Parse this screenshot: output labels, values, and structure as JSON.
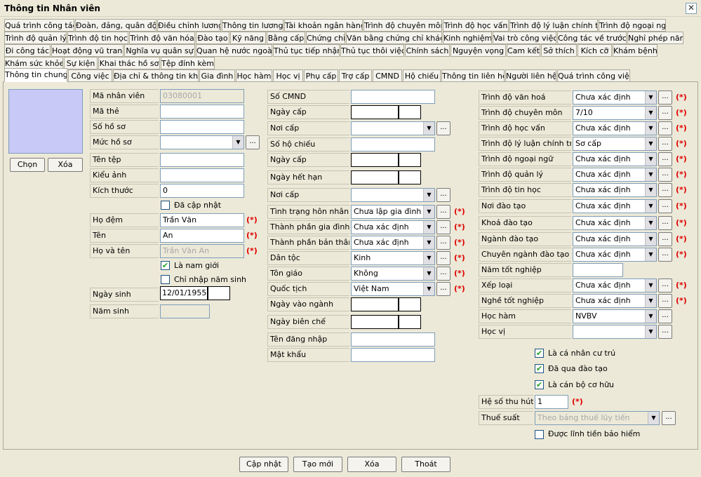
{
  "window": {
    "title": "Thông tin Nhân viên",
    "close": "✕"
  },
  "tabs": {
    "row1": [
      "Quá trình công tác",
      "Đoàn, đảng, quân đội",
      "Điều chỉnh lương",
      "Thông tin lương",
      "Tài khoản ngân hàng",
      "Trình độ chuyên môn",
      "Trình độ học vấn",
      "Trình độ lý luận chính trị",
      "Trình độ ngoại ngữ"
    ],
    "row2": [
      "Trình độ quản lý",
      "Trình độ tin học",
      "Trình độ văn hóa",
      "Đào tạo",
      "Kỹ năng",
      "Bằng cấp",
      "Chứng chỉ",
      "Văn bằng chứng chỉ khác",
      "Kinh nghiệm",
      "Vai trò công việc",
      "Công tác về trước",
      "Nghỉ phép năm"
    ],
    "row3": [
      "Đi công tác",
      "Hoạt động vũ trang",
      "Nghĩa vụ quân sự",
      "Quan hệ nước ngoài",
      "Thủ tục tiếp nhận",
      "Thủ tục thôi việc",
      "Chính sách",
      "Nguyện vọng",
      "Cam kết",
      "Sở thích",
      "Kích cỡ",
      "Khám bệnh"
    ],
    "row4": [
      "Khám sức khỏe",
      "Sự kiện",
      "Khai thác hồ sơ",
      "Tệp đính kèm"
    ],
    "row5": [
      "Thông tin chung",
      "Công việc",
      "Địa chỉ & thông tin khác",
      "Gia đình",
      "Học hàm",
      "Học vị",
      "Phụ cấp",
      "Trợ cấp",
      "CMND",
      "Hộ chiếu",
      "Thông tin liên hệ",
      "Người liên hệ",
      "Quá trình công việc"
    ]
  },
  "photo": {
    "choose_label": "Chọn",
    "delete_label": "Xóa"
  },
  "left": {
    "ma_nhan_vien": {
      "label": "Mã nhân viên",
      "value": "03080001"
    },
    "ma_the": {
      "label": "Mã thẻ",
      "value": ""
    },
    "so_ho_so": {
      "label": "Số hồ sơ",
      "value": ""
    },
    "muc_ho_so": {
      "label": "Mức hồ sơ",
      "value": ""
    },
    "ten_tep": {
      "label": "Tên tệp",
      "value": ""
    },
    "kieu_anh": {
      "label": "Kiểu ảnh",
      "value": ""
    },
    "kich_thuoc": {
      "label": "Kích thước",
      "value": "0"
    },
    "da_cap_nhat": {
      "label": "Đã cập nhật",
      "checked": false
    },
    "ho_dem": {
      "label": "Họ đệm",
      "value": "Trần Văn"
    },
    "ten": {
      "label": "Tên",
      "value": "An"
    },
    "ho_va_ten": {
      "label": "Họ và tên",
      "value": "Trần Văn An"
    },
    "la_nam_gioi": {
      "label": "Là nam giới",
      "checked": true
    },
    "chi_nhap_nam_sinh": {
      "label": "Chỉ nhập năm sinh",
      "checked": false
    },
    "ngay_sinh": {
      "label": "Ngày sinh",
      "value": "12/01/1955"
    },
    "nam_sinh": {
      "label": "Năm sinh",
      "value": ""
    }
  },
  "middle": {
    "so_cmnd": {
      "label": "Số CMND",
      "value": ""
    },
    "ngay_cap": {
      "label": "Ngày cấp"
    },
    "noi_cap": {
      "label": "Nơi cấp",
      "value": ""
    },
    "so_ho_chieu": {
      "label": "Số hộ chiếu",
      "value": ""
    },
    "ngay_cap_hc": {
      "label": "Ngày cấp"
    },
    "ngay_het_han": {
      "label": "Ngày hết hạn"
    },
    "noi_cap_hc": {
      "label": "Nơi cấp",
      "value": ""
    },
    "tinh_trang_hon_nhan": {
      "label": "Tình trạng hôn nhân",
      "value": "Chưa lập gia đình"
    },
    "thanh_phan_gia_dinh": {
      "label": "Thành phần gia đình",
      "value": "Chưa xác định"
    },
    "thanh_phan_ban_than": {
      "label": "Thành phần bản thân",
      "value": "Chưa xác định"
    },
    "dan_toc": {
      "label": "Dân tộc",
      "value": "Kinh"
    },
    "ton_giao": {
      "label": "Tôn giáo",
      "value": "Không"
    },
    "quoc_tich": {
      "label": "Quốc tịch",
      "value": "Việt Nam"
    },
    "ngay_vao_nganh": {
      "label": "Ngày vào ngành"
    },
    "ngay_bien_che": {
      "label": "Ngày biên chế"
    },
    "ten_dang_nhap": {
      "label": "Tên đăng nhập",
      "value": ""
    },
    "mat_khau": {
      "label": "Mật khẩu",
      "value": ""
    }
  },
  "right": {
    "trinh_do_van_hoa": {
      "label": "Trình độ văn hoá",
      "value": "Chưa xác định"
    },
    "trinh_do_chuyen_mon": {
      "label": "Trình độ chuyên môn",
      "value": "7/10"
    },
    "trinh_do_hoc_van": {
      "label": "Trình độ học vấn",
      "value": "Chưa xác định"
    },
    "trinh_do_ly_luan": {
      "label": "Trình độ lý luận chính trị",
      "value": "Sơ cấp"
    },
    "trinh_do_ngoai_ngu": {
      "label": "Trình độ ngoại ngữ",
      "value": "Chưa xác định"
    },
    "trinh_do_quan_ly": {
      "label": "Trình độ quản lý",
      "value": "Chưa xác định"
    },
    "trinh_do_tin_hoc": {
      "label": "Trình độ tin học",
      "value": "Chưa xác định"
    },
    "noi_dao_tao": {
      "label": "Nơi đào tạo",
      "value": "Chưa xác định"
    },
    "khoa_dao_tao": {
      "label": "Khoá đào tạo",
      "value": "Chưa xác định"
    },
    "nganh_dao_tao": {
      "label": "Ngành đào tạo",
      "value": "Chưa xác định"
    },
    "chuyen_nganh": {
      "label": "Chuyên ngành đào tạo",
      "value": "Chưa xác định"
    },
    "nam_tot_nghiep": {
      "label": "Năm tốt nghiệp",
      "value": ""
    },
    "xep_loai": {
      "label": "Xếp loại",
      "value": "Chưa xác định"
    },
    "nghe_tot_nghiep": {
      "label": "Nghề tốt nghiệp",
      "value": "Chưa xác định"
    },
    "hoc_ham": {
      "label": "Học hàm",
      "value": "NVBV"
    },
    "hoc_vi": {
      "label": "Học vị",
      "value": ""
    },
    "la_ca_nhan_cu_tru": {
      "label": "Là cá nhân cư trú",
      "checked": true
    },
    "da_qua_dao_tao": {
      "label": "Đã qua đào tạo",
      "checked": true
    },
    "la_can_bo_co_huu": {
      "label": "Là cán bộ cơ hữu",
      "checked": true
    },
    "he_so_thu_hut": {
      "label": "Hệ số thu hút",
      "value": "1"
    },
    "thue_suat": {
      "label": "Thuế suất",
      "value": "Theo bảng thuế lũy tiến"
    },
    "duoc_linh_tien": {
      "label": "Được lĩnh tiền bảo hiểm",
      "checked": false
    }
  },
  "required_mark": "(*)",
  "dots_label": "...",
  "dropdown_arrow": "▼",
  "check_mark": "✔",
  "footer": {
    "update": "Cập nhật",
    "new": "Tạo mới",
    "delete": "Xóa",
    "exit": "Thoát"
  }
}
